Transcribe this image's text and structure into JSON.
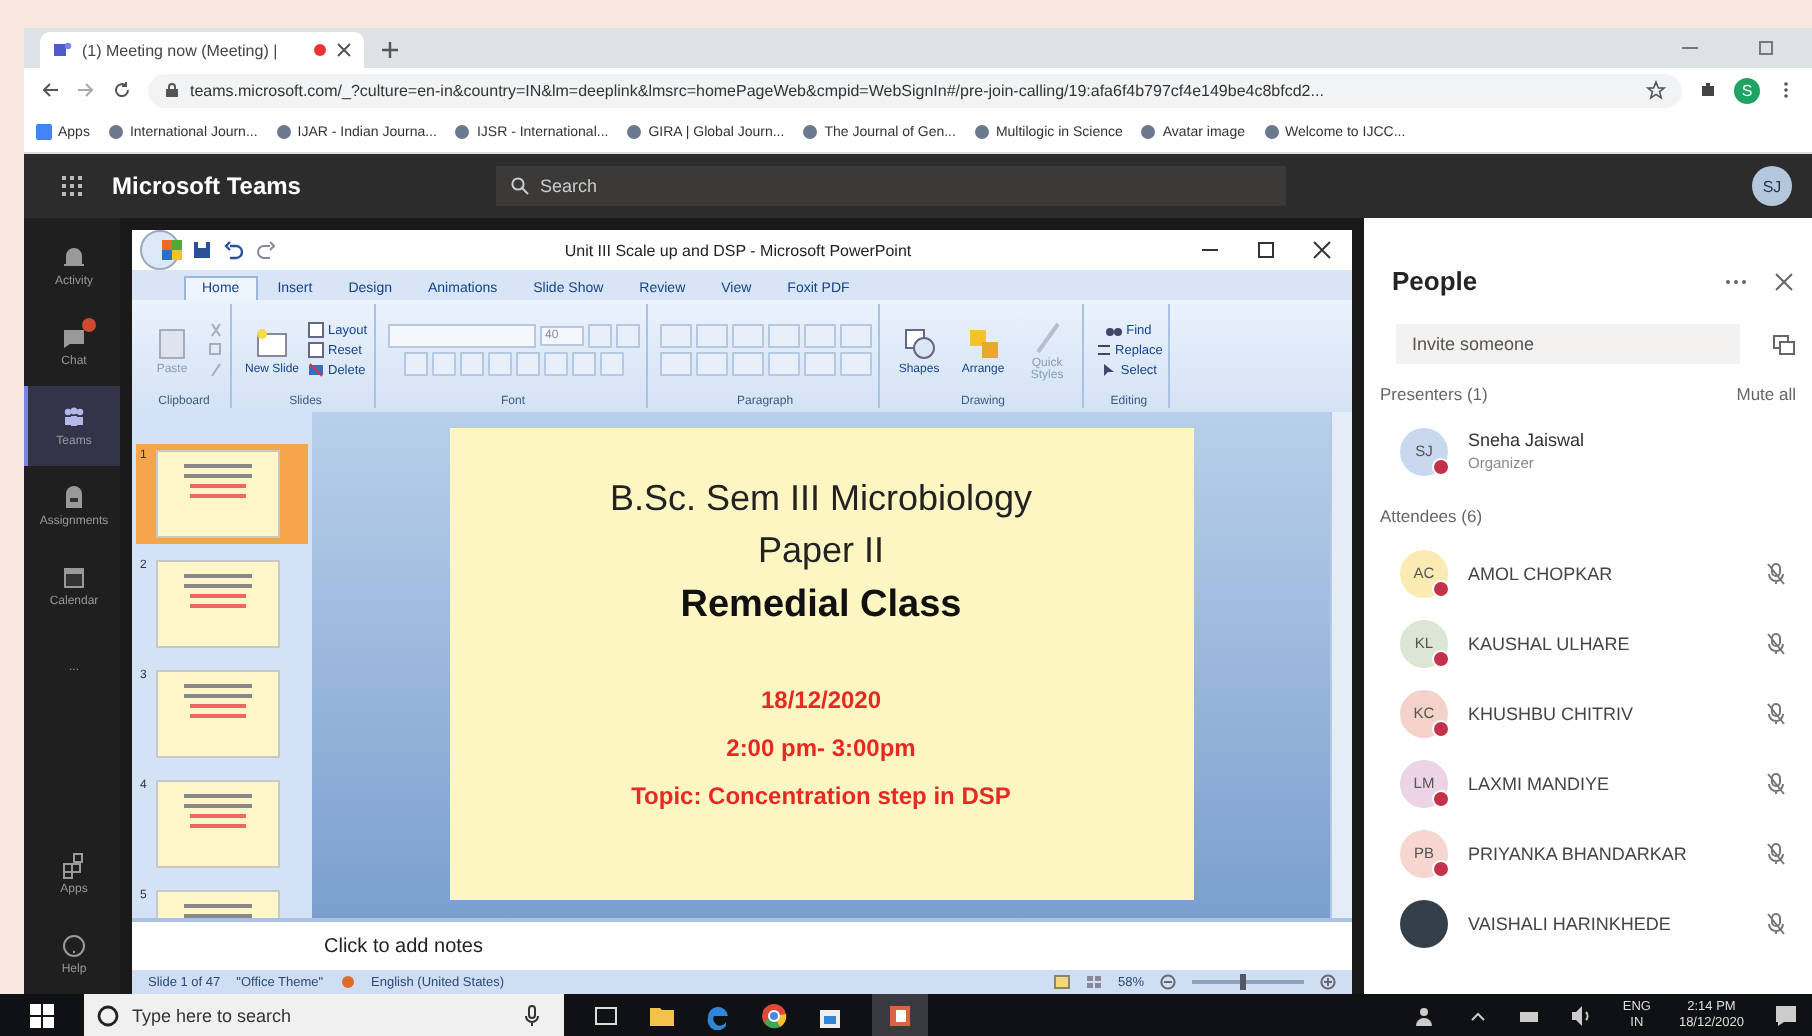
{
  "browser": {
    "tab_title": "(1) Meeting now (Meeting) |",
    "url": "teams.microsoft.com/_?culture=en-in&country=IN&lm=deeplink&lmsrc=homePageWeb&cmpid=WebSignIn#/pre-join-calling/19:afa6f4b797cf4e149be4c8bfcd2...",
    "profile_initial": "S",
    "bookmarks": [
      "Apps",
      "International Journ...",
      "IJAR - Indian Journa...",
      "IJSR - International...",
      "GIRA | Global Journ...",
      "The Journal of Gen...",
      "Multilogic in Science",
      "Avatar image",
      "Welcome to IJCC..."
    ]
  },
  "teams": {
    "title": "Microsoft Teams",
    "search_placeholder": "Search",
    "avatar": "SJ",
    "rail": [
      {
        "label": "Activity",
        "kind": "bell",
        "selected": false,
        "badge": false
      },
      {
        "label": "Chat",
        "kind": "chat",
        "selected": false,
        "badge": true
      },
      {
        "label": "Teams",
        "kind": "teams",
        "selected": true,
        "badge": false
      },
      {
        "label": "Assignments",
        "kind": "bag",
        "selected": false,
        "badge": false
      },
      {
        "label": "Calendar",
        "kind": "calendar",
        "selected": false,
        "badge": false
      },
      {
        "label": "...",
        "kind": "more",
        "selected": false,
        "badge": false
      },
      {
        "label": "Apps",
        "kind": "apps",
        "selected": false,
        "badge": false
      },
      {
        "label": "Help",
        "kind": "help",
        "selected": false,
        "badge": false
      }
    ]
  },
  "powerpoint": {
    "title": "Unit III Scale up and DSP - Microsoft PowerPoint",
    "tabs": [
      {
        "label": "Home",
        "selected": true
      },
      {
        "label": "Insert",
        "selected": false
      },
      {
        "label": "Design",
        "selected": false
      },
      {
        "label": "Animations",
        "selected": false
      },
      {
        "label": "Slide Show",
        "selected": false
      },
      {
        "label": "Review",
        "selected": false
      },
      {
        "label": "View",
        "selected": false
      },
      {
        "label": "Foxit PDF",
        "selected": false
      }
    ],
    "ribbon": {
      "paste": "Paste",
      "new_slide": "New Slide",
      "layout": "Layout",
      "reset": "Reset",
      "delete": "Delete",
      "font_size": "40",
      "shapes": "Shapes",
      "arrange": "Arrange",
      "quick_styles": "Quick Styles",
      "find": "Find",
      "replace": "Replace",
      "select": "Select",
      "groups": [
        "Clipboard",
        "Slides",
        "Font",
        "Paragraph",
        "Drawing",
        "Editing"
      ]
    },
    "thumbnails": [
      {
        "number": "1",
        "selected": true
      },
      {
        "number": "2",
        "selected": false
      },
      {
        "number": "3",
        "selected": false
      },
      {
        "number": "4",
        "selected": false
      },
      {
        "number": "5",
        "selected": false
      }
    ],
    "slide": {
      "lines": [
        {
          "text": "B.Sc. Sem III Microbiology",
          "kind": "title"
        },
        {
          "text": "Paper II",
          "kind": "title"
        },
        {
          "text": "Remedial Class",
          "kind": "heading"
        },
        {
          "text": "18/12/2020",
          "kind": "red"
        },
        {
          "text": "2:00 pm- 3:00pm",
          "kind": "red"
        },
        {
          "text": "Topic: Concentration step in DSP",
          "kind": "red"
        }
      ]
    },
    "notes_placeholder": "Click to add notes",
    "status": {
      "slide": "Slide 1 of 47",
      "theme": "\"Office Theme\"",
      "language": "English (United States)",
      "zoom": "58%",
      "zoom_slider": {
        "level": 0.45
      }
    }
  },
  "people": {
    "title": "People",
    "invite_placeholder": "Invite someone",
    "presenters_heading": "Presenters (1)",
    "mute_all": "Mute all",
    "presenters": [
      {
        "initials": "SJ",
        "name": "Sneha Jaiswal",
        "role": "Organizer",
        "color": "#c9d8ee"
      }
    ],
    "attendees_heading": "Attendees (6)",
    "attendees": [
      {
        "initials": "AC",
        "name": "AMOL CHOPKAR",
        "color": "#fbeab2",
        "photo": false
      },
      {
        "initials": "KL",
        "name": "KAUSHAL ULHARE",
        "color": "#dbe7d3",
        "photo": false
      },
      {
        "initials": "KC",
        "name": "KHUSHBU CHITRIV",
        "color": "#f3d3c9",
        "photo": false
      },
      {
        "initials": "LM",
        "name": "LAXMI MANDIYE",
        "color": "#ecd3e6",
        "photo": false
      },
      {
        "initials": "PB",
        "name": "PRIYANKA BHANDARKAR",
        "color": "#f7d6cf",
        "photo": false
      },
      {
        "name": "VAISHALI HARINKHEDE",
        "color": "#33404a",
        "photo": true
      }
    ]
  },
  "taskbar": {
    "search_placeholder": "Type here to search",
    "language": "ENG",
    "region": "IN",
    "time": "2:14 PM",
    "date": "18/12/2020"
  }
}
